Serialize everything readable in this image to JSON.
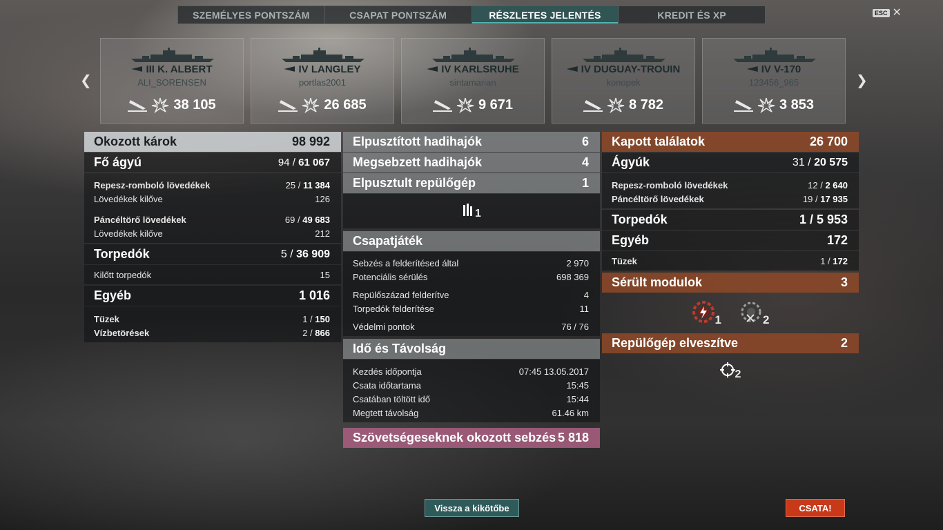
{
  "tabs": [
    {
      "label": "SZEMÉLYES PONTSZÁM",
      "active": false
    },
    {
      "label": "CSAPAT PONTSZÁM",
      "active": false
    },
    {
      "label": "RÉSZLETES JELENTÉS",
      "active": true
    },
    {
      "label": "KREDIT ÉS XP",
      "active": false
    }
  ],
  "esc_label": "ESC",
  "ships": [
    {
      "tier_name": "III K. ALBERT",
      "player": "ALI_SORENSEN",
      "damage": "38 105"
    },
    {
      "tier_name": "IV LANGLEY",
      "player": "portlas2001",
      "damage": "26 685"
    },
    {
      "tier_name": "IV KARLSRUHE",
      "player": "sintamarian",
      "damage": "9 671"
    },
    {
      "tier_name": "IV DUGUAY-TROUIN",
      "player": "konopek",
      "damage": "8 782"
    },
    {
      "tier_name": "IV V-170",
      "player": "123456_965",
      "damage": "3 853"
    }
  ],
  "left": {
    "caused": {
      "label": "Okozott károk",
      "value": "98 992"
    },
    "main": {
      "label": "Fő ágyú",
      "hits": "94 /",
      "dmg": "61 067"
    },
    "he": {
      "label": "Repesz-romboló lövedékek",
      "hits": "25 /",
      "dmg": "11 384"
    },
    "he_fired": {
      "label": "Lövedékek kilőve",
      "value": "126"
    },
    "ap": {
      "label": "Páncéltörő lövedékek",
      "hits": "69 /",
      "dmg": "49 683"
    },
    "ap_fired": {
      "label": "Lövedékek kilőve",
      "value": "212"
    },
    "torp": {
      "label": "Torpedók",
      "hits": "5 /",
      "dmg": "36 909"
    },
    "torp_fired": {
      "label": "Kilőtt torpedók",
      "value": "15"
    },
    "other": {
      "label": "Egyéb",
      "value": "1 016"
    },
    "fires": {
      "label": "Tüzek",
      "hits": "1 /",
      "dmg": "150"
    },
    "flood": {
      "label": "Vízbetörések",
      "hits": "2 /",
      "dmg": "866"
    }
  },
  "middle": {
    "destroyed": {
      "label": "Elpusztított hadihajók",
      "value": "6"
    },
    "damaged": {
      "label": "Megsebzett hadihajók",
      "value": "4"
    },
    "planes": {
      "label": "Elpusztult repülőgép",
      "value": "1"
    },
    "plane_icon_count": "1",
    "team": {
      "label": "Csapatjáték"
    },
    "spot_dmg": {
      "label": "Sebzés a felderítésed által",
      "value": "2 970"
    },
    "potential": {
      "label": "Potenciális sérülés",
      "value": "698 369"
    },
    "squad_spot": {
      "label": "Repülőszázad felderítve",
      "value": "4"
    },
    "torp_spot": {
      "label": "Torpedók felderítése",
      "value": "11"
    },
    "defense": {
      "label": "Védelmi pontok",
      "value": "76 / 76"
    },
    "time": {
      "label": "Idő és Távolság"
    },
    "start": {
      "label": "Kezdés időpontja",
      "value": "07:45  13.05.2017"
    },
    "duration": {
      "label": "Csata időtartama",
      "value": "15:45"
    },
    "in_battle": {
      "label": "Csatában töltött idő",
      "value": "15:44"
    },
    "distance": {
      "label": "Megtett távolság",
      "value": "61.46 km"
    },
    "ally_dmg": {
      "label": "Szövetségeseknek okozott sebzés",
      "value": "5 818"
    }
  },
  "right": {
    "received": {
      "label": "Kapott találatok",
      "value": "26 700"
    },
    "guns": {
      "label": "Ágyúk",
      "hits": "31 /",
      "dmg": "20 575"
    },
    "he": {
      "label": "Repesz-romboló lövedékek",
      "hits": "12 /",
      "dmg": "2 640"
    },
    "ap": {
      "label": "Páncéltörő lövedékek",
      "hits": "19 /",
      "dmg": "17 935"
    },
    "torp": {
      "label": "Torpedók",
      "value": "1 / 5 953"
    },
    "other": {
      "label": "Egyéb",
      "value": "172"
    },
    "fires": {
      "label": "Tüzek",
      "hits": "1 /",
      "dmg": "172"
    },
    "modules": {
      "label": "Sérült modulok",
      "value": "3"
    },
    "module_icons": [
      {
        "count": "1"
      },
      {
        "count": "2"
      }
    ],
    "planes_lost": {
      "label": "Repülőgép elveszítve",
      "value": "2"
    },
    "target_count": "2"
  },
  "buttons": {
    "back": "Vissza a kikötőbe",
    "battle": "CSATA!"
  }
}
